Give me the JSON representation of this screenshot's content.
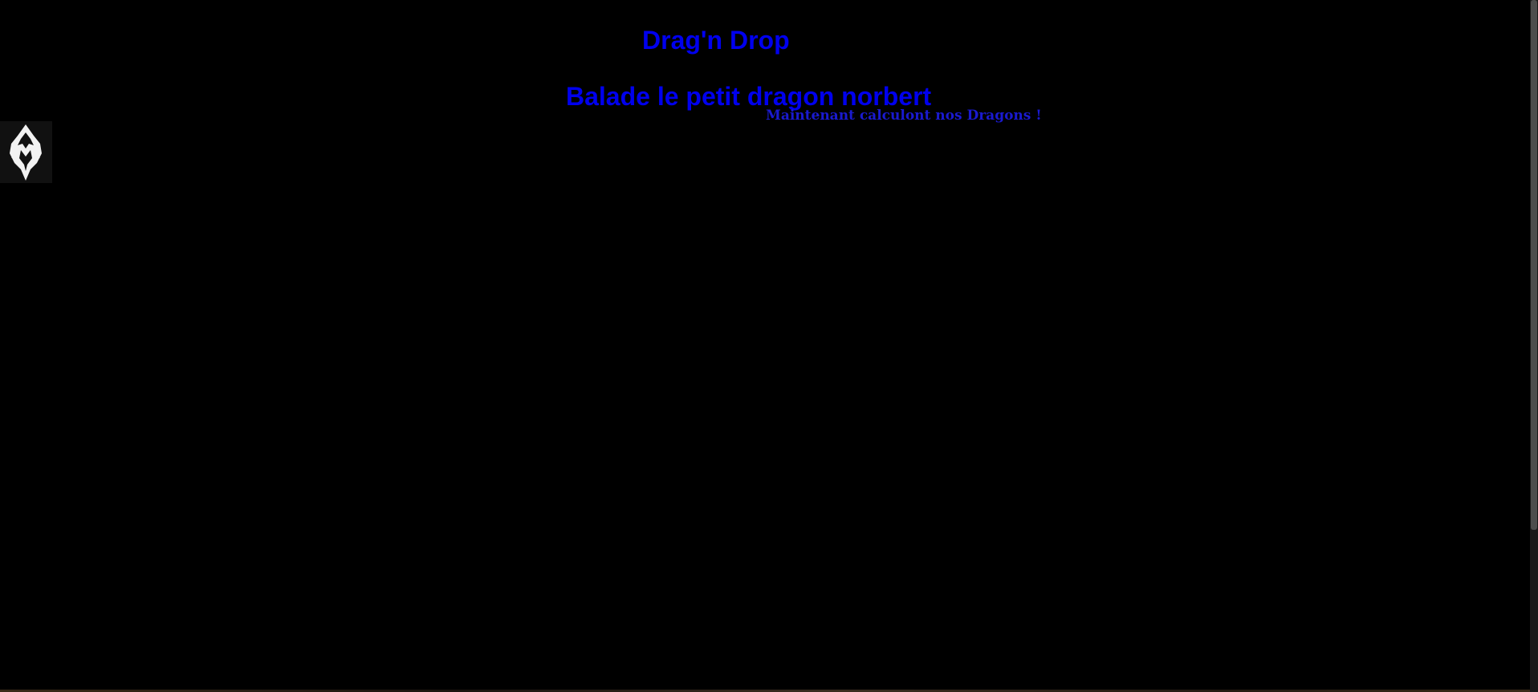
{
  "header": {
    "title": "Drag'n Drop",
    "subtitle": "Balade le petit dragon norbert"
  },
  "calc": {
    "text": "Maintenant calculont nos Dragons !"
  },
  "draggable": {
    "icon": "skyrim-dragon-emblem-icon"
  },
  "colors": {
    "background": "#000000",
    "text_blue": "#0000ee",
    "calc_blue": "#1a1ad0"
  }
}
